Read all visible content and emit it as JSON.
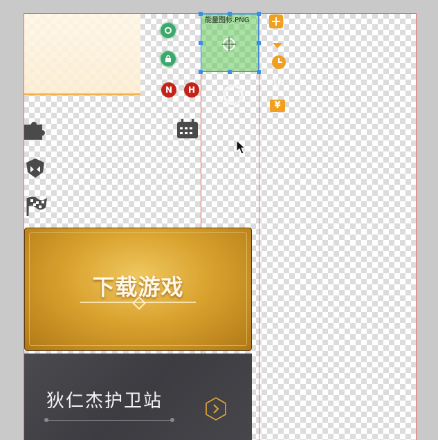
{
  "layer_label": "能量图标.PNG",
  "badges": {
    "n_label": "N",
    "h_label": "H"
  },
  "download_banner": {
    "title": "下载游戏"
  },
  "guard_banner": {
    "title": "狄仁杰护卫站"
  },
  "yen_symbol": "¥",
  "colors": {
    "gold": "#d9a22e",
    "guard_bg": "#46464b",
    "selection": "#3b8fe0",
    "accent_orange": "#f0a020",
    "guide_red": "#ee6b6b",
    "status_green": "#3aa96b",
    "status_red": "#c4231a"
  },
  "icons": [
    "gear-icon",
    "lock-icon",
    "calendar-icon",
    "puzzle-icon",
    "helmet-icon",
    "flag-icon",
    "plus-icon",
    "clock-icon",
    "yen-icon",
    "crosshair-icon",
    "chevron-right-icon",
    "cursor-icon"
  ]
}
